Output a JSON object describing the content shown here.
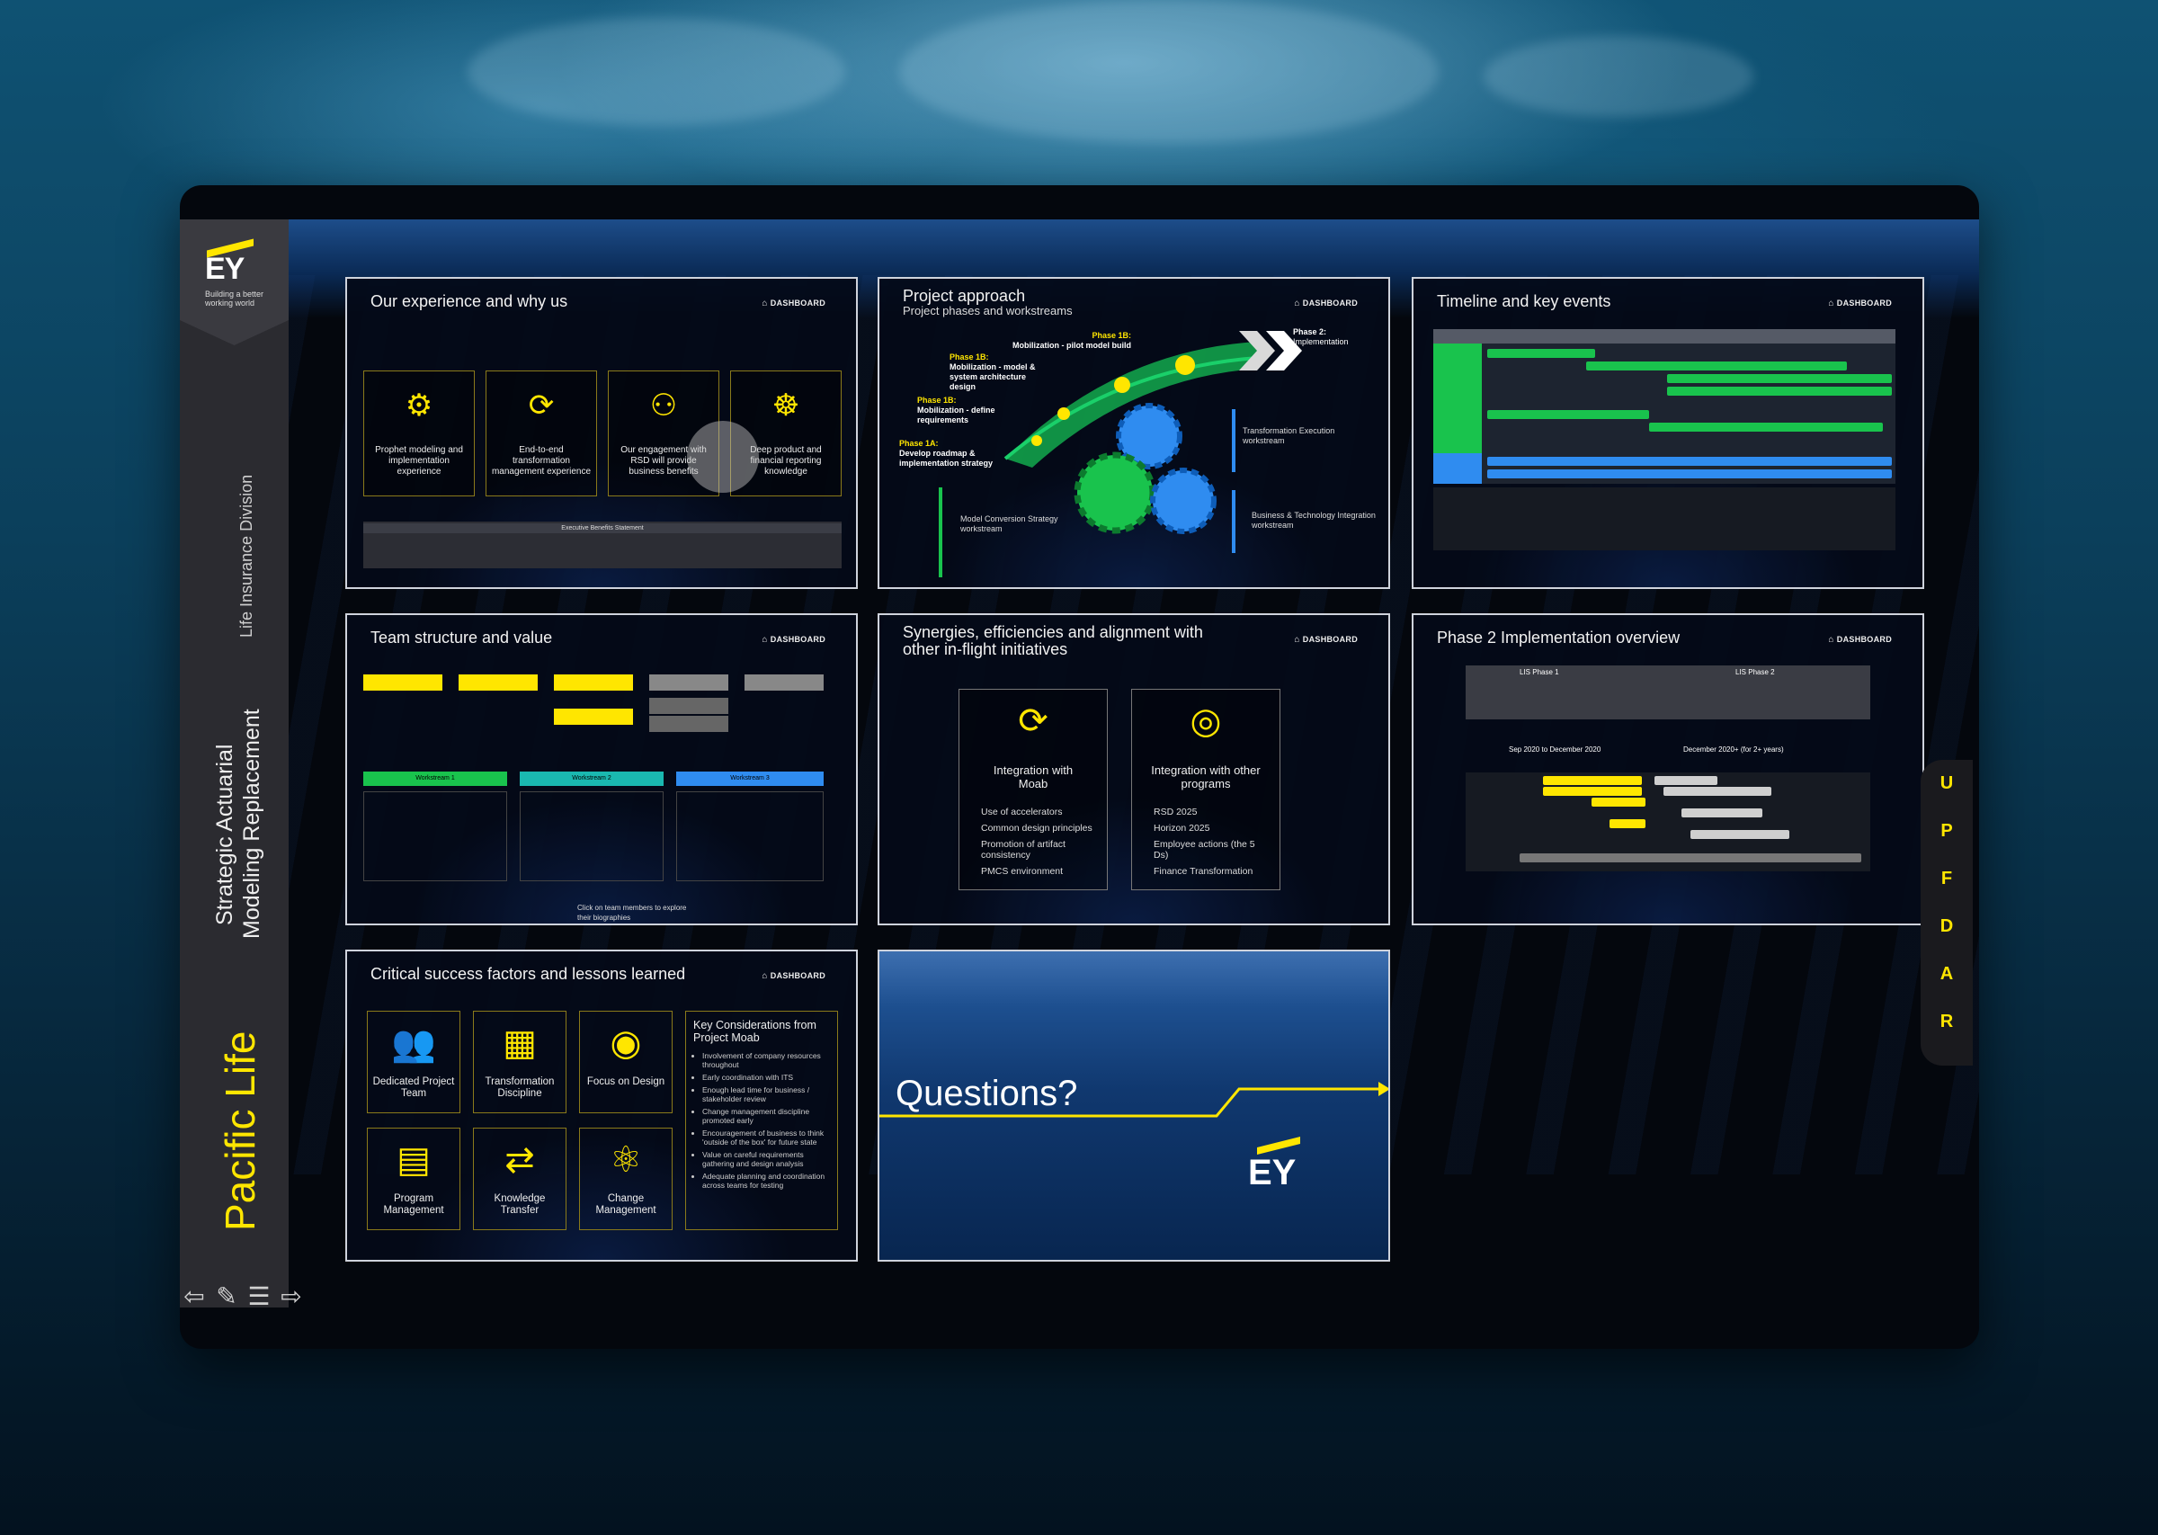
{
  "sidebar": {
    "logo_text": "EY",
    "logo_tagline": "Building a better working world",
    "division": "Life Insurance Division",
    "project_line1": "Strategic Actuarial",
    "project_line2": "Modeling Replacement",
    "client": "Pacific Life",
    "tools": [
      "back-arrow-icon",
      "pencil-icon",
      "menu-icon",
      "forward-arrow-icon"
    ]
  },
  "dashboard_label": "DASHBOARD",
  "cards": {
    "experience": {
      "title": "Our experience and why us",
      "boxes": [
        "Prophet modeling and implementation experience",
        "End-to-end transformation management experience",
        "Our engagement with RSD will provide business benefits",
        "Deep product and financial reporting knowledge"
      ],
      "footer": "Executive Benefits Statement"
    },
    "approach": {
      "title": "Project approach",
      "subtitle": "Project phases and workstreams",
      "phases": [
        {
          "label": "Phase 2:",
          "sub": "Implementation"
        },
        {
          "label": "Phase 1B:",
          "sub": "Mobilization - pilot model build"
        },
        {
          "label": "Phase 1B:",
          "sub": "Mobilization - model & system architecture design"
        },
        {
          "label": "Phase 1B:",
          "sub": "Mobilization - define requirements"
        },
        {
          "label": "Phase 1A:",
          "sub": "Develop roadmap & implementation strategy"
        }
      ],
      "workstreams": [
        "Transformation Execution workstream",
        "Model Conversion Strategy workstream",
        "Business & Technology Integration workstream"
      ],
      "gears": [
        "Transformation Execution",
        "Model Conversion Strategy",
        "Business & Tech Integration"
      ]
    },
    "timeline": {
      "title": "Timeline and key events"
    },
    "team": {
      "title": "Team structure and value",
      "workstreams": [
        "Workstream 1",
        "Workstream 2",
        "Workstream 3"
      ],
      "footer": "Click on team members to explore their biographies"
    },
    "synergies": {
      "title": "Synergies, efficiencies and alignment with other in-flight initiatives",
      "left": {
        "title": "Integration with Moab",
        "items": [
          "Use of accelerators",
          "Common design principles",
          "Promotion of artifact consistency",
          "PMCS environment"
        ]
      },
      "right": {
        "title": "Integration with other programs",
        "items": [
          "RSD 2025",
          "Horizon 2025",
          "Employee actions (the 5 Ds)",
          "Finance Transformation"
        ]
      }
    },
    "phase2": {
      "title": "Phase 2 Implementation overview",
      "col1": "Sep 2020 to December 2020",
      "col2": "December 2020+ (for 2+ years)",
      "h1": "LIS Phase 1",
      "h2": "LIS Phase 2"
    },
    "csf": {
      "title": "Critical success factors and lessons learned",
      "factors": [
        "Dedicated Project Team",
        "Transformation Discipline",
        "Focus on Design",
        "Program Management",
        "Knowledge Transfer",
        "Change Management"
      ],
      "key_title": "Key Considerations from Project Moab",
      "key_items": [
        "Involvement of company resources throughout",
        "Early coordination with ITS",
        "Enough lead time for business / stakeholder review",
        "Change management discipline promoted early",
        "Encouragement of business to think 'outside of the box' for future state",
        "Value on careful requirements gathering and design analysis",
        "Adequate planning and coordination across teams for testing"
      ]
    },
    "questions": {
      "title": "Questions?",
      "logo": "EY"
    }
  },
  "right_nav": [
    "U",
    "P",
    "F",
    "D",
    "A",
    "R"
  ],
  "colors": {
    "accent": "#ffe600",
    "frame": "#04070d",
    "sidebar": "#2b2b30"
  }
}
